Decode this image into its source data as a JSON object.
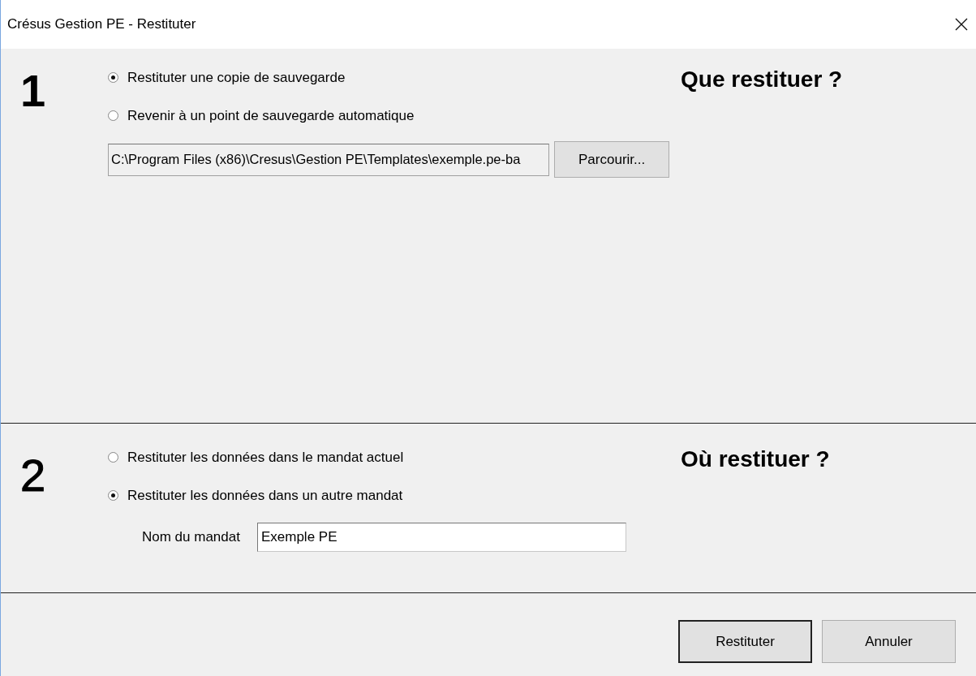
{
  "window": {
    "title": "Crésus Gestion PE - Restituter"
  },
  "sections": [
    {
      "number": "1",
      "heading": "Que restituer ?",
      "options": [
        {
          "label": "Restituter une copie de sauvegarde",
          "selected": true
        },
        {
          "label": "Revenir à un point de sauvegarde automatique",
          "selected": false
        }
      ],
      "field": {
        "kind": "path",
        "value": "C:\\Program Files (x86)\\Cresus\\Gestion PE\\Templates\\exemple.pe-ba",
        "button": "Parcourir..."
      }
    },
    {
      "number": "2",
      "heading": "Où restituer ?",
      "options": [
        {
          "label": "Restituter les données dans le mandat actuel",
          "selected": false
        },
        {
          "label": "Restituter les données dans un autre mandat",
          "selected": true
        }
      ],
      "field": {
        "kind": "name",
        "label": "Nom du mandat",
        "value": "Exemple PE"
      }
    }
  ],
  "buttons": [
    {
      "label": "Restituter",
      "default": true
    },
    {
      "label": "Annuler",
      "default": false
    }
  ]
}
